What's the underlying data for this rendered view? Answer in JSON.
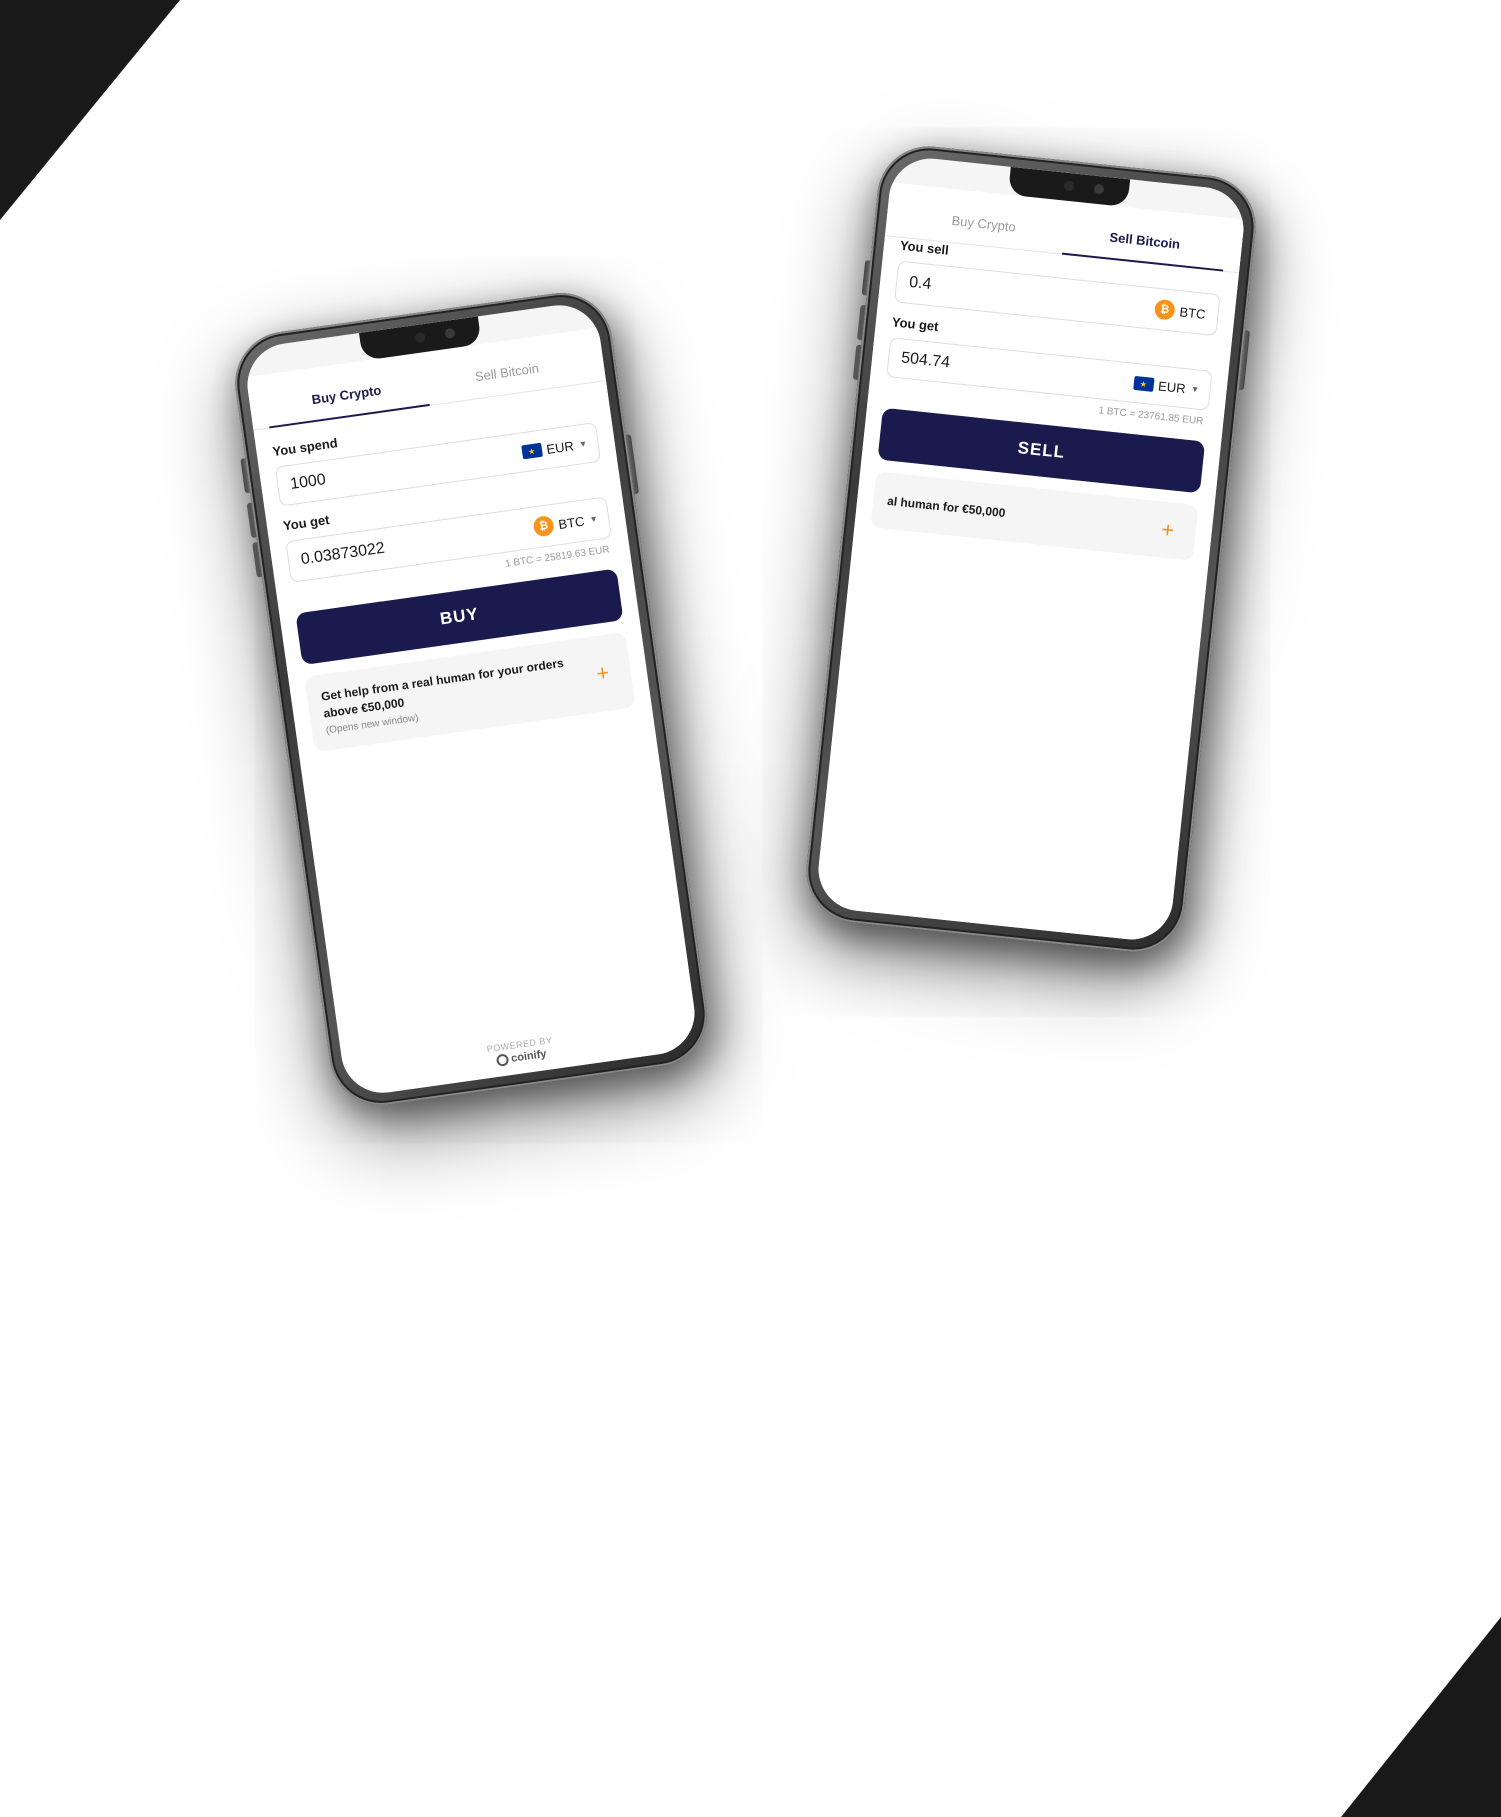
{
  "background": {
    "color": "#ffffff"
  },
  "phone_left": {
    "active_tab": "buy",
    "tabs": [
      {
        "id": "buy",
        "label": "Buy Crypto",
        "active": true
      },
      {
        "id": "sell",
        "label": "Sell Bitcoin",
        "active": false
      }
    ],
    "you_spend_label": "You spend",
    "spend_value": "1000",
    "spend_currency": "EUR",
    "you_get_label": "You get",
    "get_value": "0.03873022",
    "get_currency": "BTC",
    "rate_text": "1 BTC = 25819.63 EUR",
    "buy_button_label": "BUY",
    "help_title": "Get help from a real human for your orders above €50,000",
    "help_sub": "(Opens new window)",
    "powered_by_label": "POWERED BY",
    "coinify_label": "coinify"
  },
  "phone_right": {
    "active_tab": "sell",
    "tabs": [
      {
        "id": "buy",
        "label": "Buy Crypto",
        "active": false
      },
      {
        "id": "sell",
        "label": "Sell Bitcoin",
        "active": true
      }
    ],
    "you_sell_label": "You sell",
    "sell_value": "0.4",
    "sell_currency": "BTC",
    "you_get_label": "You get",
    "get_value": "504.74",
    "get_currency": "EUR",
    "rate_text": "1 BTC = 23761.85 EUR",
    "sell_button_label": "SELL",
    "help_title": "al human for €50,000",
    "plus_icon": "+"
  }
}
